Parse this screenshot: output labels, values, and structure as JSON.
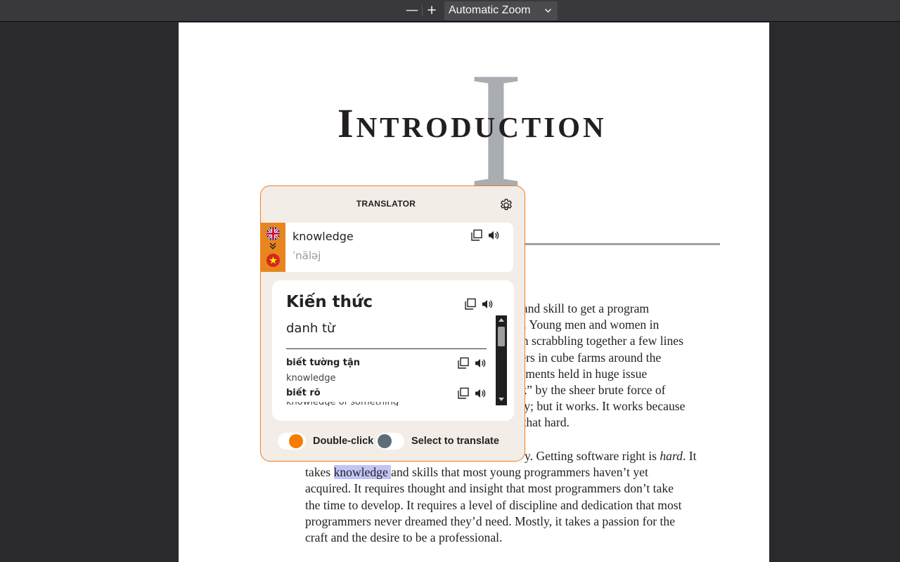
{
  "toolbar": {
    "zoom_out": "—",
    "zoom_in": "+",
    "zoom_value": "Automatic Zoom"
  },
  "document": {
    "chapter_letter": "I",
    "chapter_title": "Introduction",
    "paragraph1": [
      "dge and skill to get a program",
      "time. Young men and women in",
      "ed on scrabbling together a few lines",
      "mmers in cube farms around the",
      "documents held in huge issue",
      "work” by the sheer brute force of",
      "pretty; but it works. It works because",
      "sn’t that hard."
    ],
    "paragraph2": {
      "line1_start": "y. Getting software right is ",
      "line1_em": "hard",
      "line1_end": ". It",
      "line2_before": "takes ",
      "line2_highlight": "knowledge ",
      "line2_after": "and skills that most young programmers haven’t yet",
      "lines": [
        "acquired. It requires thought and insight that most programmers don’t take",
        "the time to develop. It requires a level of discipline and dedication that most",
        "programmers never dreamed they’d need. Mostly, it takes a passion for the",
        "craft and the desire to be a professional."
      ]
    }
  },
  "translator": {
    "title": "TRANSLATOR",
    "source_word": "knowledge",
    "source_phonetic": "ˈnäləj",
    "result_word": "Kiến thức",
    "result_pos": "danh từ",
    "synonyms": [
      {
        "word": "biết tường tận",
        "meaning": "knowledge"
      },
      {
        "word": "biết rõ",
        "meaning": "knowledge of something"
      }
    ],
    "toggle_double_click": "Double-click",
    "toggle_select": "Select to translate"
  },
  "colors": {
    "accent": "#f07c1c",
    "highlight": "#c2c4f6"
  }
}
